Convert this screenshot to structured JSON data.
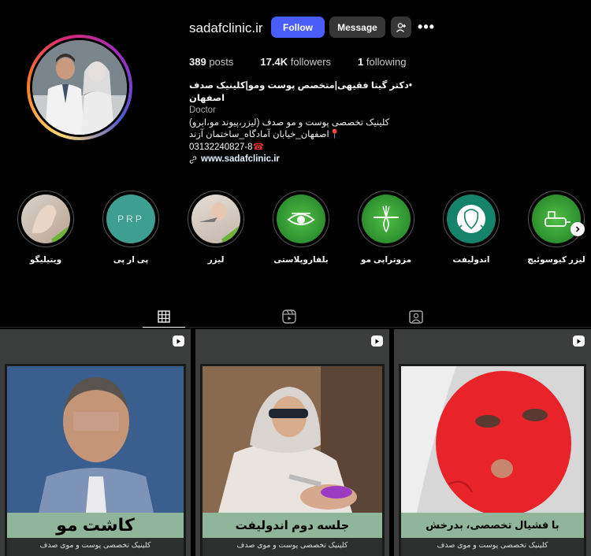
{
  "profile": {
    "username": "sadafclinic.ir",
    "follow_label": "Follow",
    "message_label": "Message",
    "more_label": "•••",
    "stats": {
      "posts_count": "389",
      "posts_label": "posts",
      "followers_count": "17.4K",
      "followers_label": "followers",
      "following_count": "1",
      "following_label": "following"
    },
    "bio": {
      "name": "•دکتر گیتا فقیهی|متخصص پوست ومو|کلینیک صدف اصفهان",
      "category": "Doctor",
      "line1": "کلینیک تخصصی پوست و مو صدف (لیزر،پیوند مو،ابرو)",
      "line2": "📍اصفهان_خیابان آمادگاه_ساختمان آزند",
      "phone": "03132240827-8",
      "link": "www.sadafclinic.ir"
    }
  },
  "highlights": [
    {
      "label": "ویتیلیگو",
      "icon": "hand-photo"
    },
    {
      "label": "پی ار پی",
      "icon": "prp-text",
      "text": "PRP"
    },
    {
      "label": "لیزر",
      "icon": "laser-photo"
    },
    {
      "label": "بلفاروپلاستی",
      "icon": "eye-icon"
    },
    {
      "label": "مزوتراپی مو",
      "icon": "hair-follicle-icon"
    },
    {
      "label": "اندولیفت",
      "icon": "face-lift-icon"
    },
    {
      "label": "لیزر کیوسوئیچ",
      "icon": "laser-device-icon"
    }
  ],
  "tabs": [
    "posts-grid-icon",
    "reels-icon",
    "tagged-icon"
  ],
  "posts": [
    {
      "caption": "کاشت مو",
      "footer": "کلینیک تخصصی پوست و موی صدف"
    },
    {
      "caption": "جلسه دوم اندولیفت",
      "footer": "کلینیک تخصصی پوست و موی صدف"
    },
    {
      "caption": "با فشیال تخصصی، بدرخش",
      "footer": "کلینیک تخصصی پوست و موی صدف"
    }
  ],
  "colors": {
    "follow_button": "#4a5df9",
    "secondary_button": "#363636",
    "caption_band": "#8fb59b",
    "highlight_green": "#2e9b3a"
  }
}
